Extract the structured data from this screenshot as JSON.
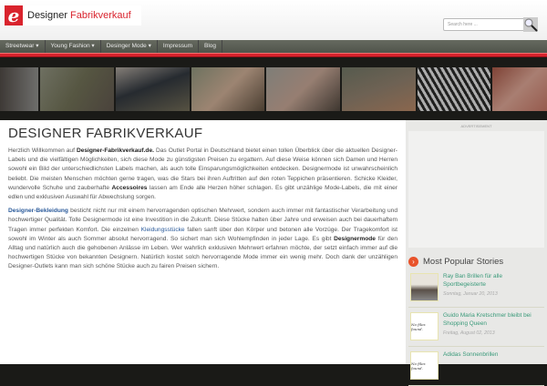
{
  "header": {
    "logo_letter": "e",
    "logo_text1": "Designer",
    "logo_text2": "Fabrikverkauf",
    "search_placeholder": "Search here ..."
  },
  "nav": [
    {
      "label": "Streetwear ▾"
    },
    {
      "label": "Young Fashion ▾"
    },
    {
      "label": "Desinger Mode ▾"
    },
    {
      "label": "Impressum"
    },
    {
      "label": "Blog"
    }
  ],
  "main": {
    "title": "DESIGNER FABRIKVERKAUF",
    "p1": {
      "a": "Herzlich Willkommen auf ",
      "b1": "Designer-Fabrikverkauf.de.",
      "c": " Das Outlet Portal in Deutschland bietet einen tollen Überblick über die aktuellen Designer-Labels und die vielfältigen Möglichkeiten, sich diese Mode zu günstigsten Preisen zu ergattern. Auf diese Weise können sich Damen und Herren sowohl ein Bild der unterschiedlichsten Labels machen, als auch tolle Einsparungsmöglichkeiten entdecken. Designermode ist unwahrscheinlich beliebt. Die meisten Menschen möchten gerne tragen, was die Stars bei ihren Auftritten auf den roten Teppichen präsentieren. Schicke Kleider, wundervolle Schuhe und zauberhafte ",
      "b2": "Accessoires",
      "d": " lassen am Ende alle Herzen höher schlagen. Es gibt unzählige Mode-Labels, die mit einer edlen und exklusiven Auswahl für Abwechslung sorgen."
    },
    "p2": {
      "link1": "Designer-Bekleidung",
      "a": " besticht nicht nur mit einem hervorragenden optischen Mehrwert, sondern auch immer mit fantastischer Verarbeitung und hochwertiger Qualität. Tolle Designermode ist eine Investition in die Zukunft. Diese Stücke halten über Jahre und erweisen auch bei dauerhaftem Tragen immer perfekten Komfort. Die einzelnen ",
      "link2": "Kleidungsstücke",
      "b": " fallen sanft über den Körper und betonen alle Vorzüge. Der Tragekomfort ist sowohl im Winter als auch Sommer absolut hervorragend. So sichert man sich Wohlempfinden in jeder Lage. Es gibt ",
      "b1": "Designermode",
      "c": " für den Alltag und natürlich auch die gehobenen Anlässe im Leben. Wer wahrlich exklusiven Mehrwert erfahren möchte, der setzt einfach immer auf die hochwertigen Stücke von bekannten Designern. Natürlich kostet solch hervorragende Mode immer ein wenig mehr. Doch dank der unzähligen Designer-Outlets kann man sich schöne Stücke auch zu fairen Preisen sichern."
    }
  },
  "sidebar": {
    "ad_label": "ADVERTISEMENT",
    "popular_title": "Most Popular Stories",
    "stories": [
      {
        "title": "Ray Ban Brillen für alle Sportbegeisterte",
        "date": "Sonntag, Januar 20, 2013",
        "thumb": ""
      },
      {
        "title": "Guido Maria Kretschmer bleibt bei Shopping Queen",
        "date": "Freitag, August 02, 2013",
        "thumb": "No files found."
      },
      {
        "title": "Adidas Sonnenbrillen",
        "date": "",
        "thumb": "No files found."
      }
    ]
  },
  "colors": {
    "accent": "#d9232d",
    "nav": "#5a5e55",
    "link": "#2a5a9a",
    "story": "#3a9a7a"
  }
}
